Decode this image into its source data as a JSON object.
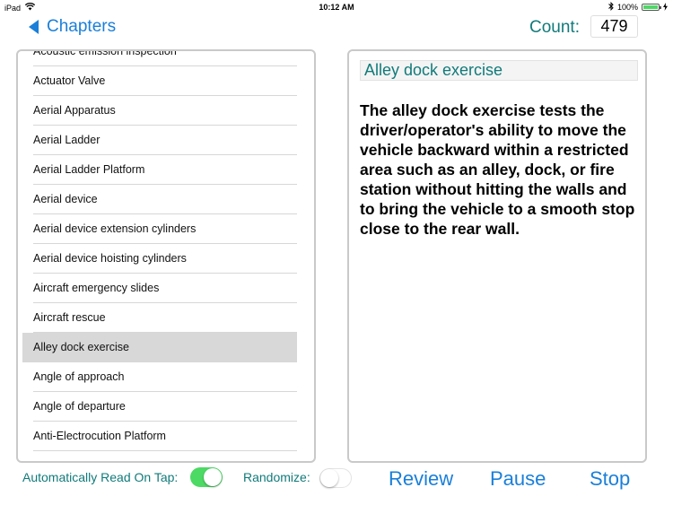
{
  "status_bar": {
    "device": "iPad",
    "time": "10:12 AM",
    "battery_percent": "100%",
    "battery_level": 1.0
  },
  "nav": {
    "back_label": "Chapters",
    "count_label": "Count:",
    "count_value": "479"
  },
  "list": {
    "items": [
      "Acoustic emission inspection",
      "Actuator Valve",
      "Aerial Apparatus",
      "Aerial Ladder",
      "Aerial Ladder Platform",
      "Aerial device",
      "Aerial device extension cylinders",
      "Aerial device hoisting cylinders",
      "Aircraft emergency slides",
      "Aircraft rescue",
      "Alley dock exercise",
      "Angle of approach",
      "Angle of departure",
      "Anti-Electrocution Platform"
    ],
    "selected_index": 10
  },
  "detail": {
    "title": "Alley dock exercise",
    "body": "The alley dock exercise tests the driver/operator's ability to move the vehicle backward within a restricted area such as an alley, dock, or fire station without hitting the walls and to bring the vehicle to a smooth stop close to the rear wall."
  },
  "controls": {
    "auto_read_label": "Automatically Read On Tap:",
    "auto_read_on": true,
    "randomize_label": "Randomize:",
    "randomize_on": false,
    "review_label": "Review",
    "pause_label": "Pause",
    "stop_label": "Stop"
  },
  "colors": {
    "accent_blue": "#1a7fd9",
    "teal": "#117a7a",
    "toggle_on": "#4cd964",
    "selection": "#d8d8d8"
  }
}
